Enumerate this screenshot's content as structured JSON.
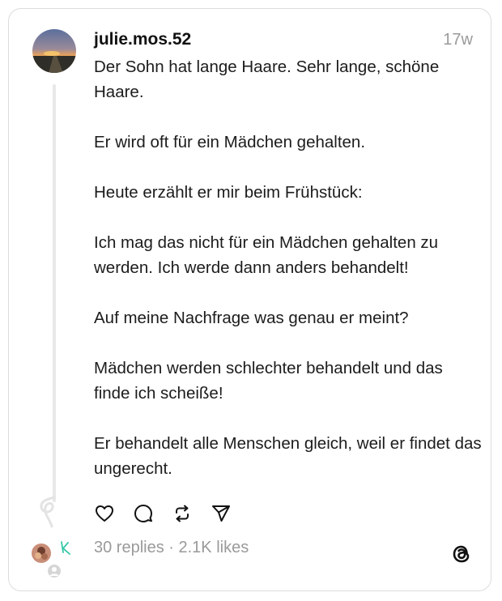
{
  "post": {
    "username": "julie.mos.52",
    "time": "17w",
    "paragraphs": [
      "Der Sohn hat lange Haare. Sehr lange, schöne Haare.",
      "Er wird oft für ein Mädchen gehalten.",
      "Heute erzählt er mir beim Frühstück:",
      "Ich mag das nicht für ein Mädchen gehalten zu werden. Ich werde dann anders behandelt!",
      "Auf meine Nachfrage was genau er meint?",
      "Mädchen werden schlechter behandelt und das finde ich scheiße!",
      "Er behandelt alle Menschen gleich, weil er findet das ungerecht."
    ],
    "stats": "30 replies · 2.1K likes"
  },
  "icons": {
    "like": "heart-icon",
    "reply": "comment-icon",
    "repost": "repost-icon",
    "share": "send-icon",
    "logo": "threads-logo-icon"
  },
  "colors": {
    "text": "#1c1c1c",
    "muted": "#9a9a9a",
    "border": "#dcdcdc"
  }
}
